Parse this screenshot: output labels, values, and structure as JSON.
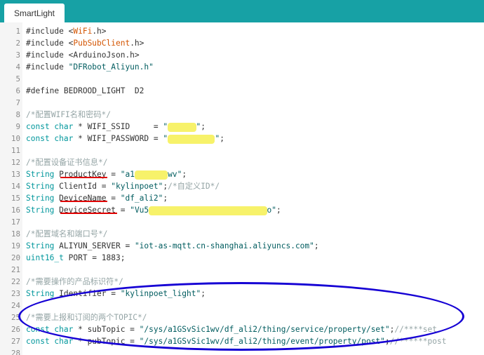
{
  "tab": {
    "title": "SmartLight"
  },
  "lines": [
    {
      "n": "1",
      "parts": [
        [
          "pp",
          "#include <"
        ],
        [
          "lib",
          "WiFi"
        ],
        [
          "pp",
          ".h>"
        ]
      ]
    },
    {
      "n": "2",
      "parts": [
        [
          "pp",
          "#include <"
        ],
        [
          "lib",
          "PubSubClient"
        ],
        [
          "pp",
          ".h>"
        ]
      ]
    },
    {
      "n": "3",
      "parts": [
        [
          "pp",
          "#include <ArduinoJson.h>"
        ]
      ]
    },
    {
      "n": "4",
      "parts": [
        [
          "pp",
          "#include "
        ],
        [
          "str",
          "\"DFRobot_Aliyun.h\""
        ]
      ]
    },
    {
      "n": "5",
      "parts": []
    },
    {
      "n": "6",
      "parts": [
        [
          "pp",
          "#define BEDROOD_LIGHT  D2"
        ]
      ]
    },
    {
      "n": "7",
      "parts": []
    },
    {
      "n": "8",
      "parts": [
        [
          "cm",
          "/*配置WIFI名和密码*/"
        ]
      ]
    },
    {
      "n": "9",
      "parts": [
        [
          "kw",
          "const char"
        ],
        [
          "pp",
          " * WIFI_SSID     = "
        ],
        [
          "str",
          "\""
        ],
        [
          "hl",
          "      "
        ],
        [
          "str",
          "\""
        ],
        [
          "pp",
          ";"
        ]
      ]
    },
    {
      "n": "10",
      "parts": [
        [
          "kw",
          "const char"
        ],
        [
          "pp",
          " * WIFI_PASSWORD = "
        ],
        [
          "str",
          "\""
        ],
        [
          "hl",
          "          "
        ],
        [
          "str",
          "\""
        ],
        [
          "pp",
          ";"
        ]
      ]
    },
    {
      "n": "11",
      "parts": []
    },
    {
      "n": "12",
      "parts": [
        [
          "cm",
          "/*配置设备证书信息*/"
        ]
      ]
    },
    {
      "n": "13",
      "parts": [
        [
          "kw",
          "String"
        ],
        [
          "pp",
          " ProductKey = "
        ],
        [
          "str",
          "\"a1"
        ],
        [
          "hl",
          "       "
        ],
        [
          "str",
          "wv\""
        ],
        [
          "pp",
          ";"
        ]
      ]
    },
    {
      "n": "14",
      "parts": [
        [
          "kw",
          "String"
        ],
        [
          "pp",
          " ClientId = "
        ],
        [
          "str",
          "\"kylinpoet\""
        ],
        [
          "pp",
          ";"
        ],
        [
          "cm",
          "/*自定义ID*/"
        ]
      ]
    },
    {
      "n": "15",
      "parts": [
        [
          "kw",
          "String"
        ],
        [
          "pp",
          " DeviceName = "
        ],
        [
          "str",
          "\"df_ali2\""
        ],
        [
          "pp",
          ";"
        ]
      ]
    },
    {
      "n": "16",
      "parts": [
        [
          "kw",
          "String"
        ],
        [
          "pp",
          " DeviceSecret = "
        ],
        [
          "str",
          "\"Vu5"
        ],
        [
          "hl",
          "                         "
        ],
        [
          "str",
          "o\""
        ],
        [
          "pp",
          ";"
        ]
      ]
    },
    {
      "n": "17",
      "parts": []
    },
    {
      "n": "18",
      "parts": [
        [
          "cm",
          "/*配置域名和端口号*/"
        ]
      ]
    },
    {
      "n": "19",
      "parts": [
        [
          "kw",
          "String"
        ],
        [
          "pp",
          " ALIYUN_SERVER = "
        ],
        [
          "str",
          "\"iot-as-mqtt.cn-shanghai.aliyuncs.com\""
        ],
        [
          "pp",
          ";"
        ]
      ]
    },
    {
      "n": "20",
      "parts": [
        [
          "kw",
          "uint16_t"
        ],
        [
          "pp",
          " PORT = 1883;"
        ]
      ]
    },
    {
      "n": "21",
      "parts": []
    },
    {
      "n": "22",
      "parts": [
        [
          "cm",
          "/*需要操作的产品标识符*/"
        ]
      ]
    },
    {
      "n": "23",
      "parts": [
        [
          "kw",
          "String"
        ],
        [
          "pp",
          " Identifier = "
        ],
        [
          "str",
          "\"kylinpoet_light\""
        ],
        [
          "pp",
          ";"
        ]
      ]
    },
    {
      "n": "24",
      "parts": []
    },
    {
      "n": "25",
      "parts": [
        [
          "cm",
          "/*需要上报和订阅的两个TOPIC*/"
        ]
      ]
    },
    {
      "n": "26",
      "parts": [
        [
          "kw",
          "const char"
        ],
        [
          "pp",
          " * subTopic = "
        ],
        [
          "str",
          "\"/sys/a1GSvSic1wv/df_ali2/thing/service/property/set\""
        ],
        [
          "pp",
          ";"
        ],
        [
          "cm",
          "//****set"
        ]
      ]
    },
    {
      "n": "27",
      "parts": [
        [
          "kw",
          "const char"
        ],
        [
          "pp",
          " * pubTopic = "
        ],
        [
          "str",
          "\"/sys/a1GSvSic1wv/df_ali2/thing/event/property/post\""
        ],
        [
          "pp",
          ";"
        ],
        [
          "cm",
          "//******post"
        ]
      ]
    },
    {
      "n": "28",
      "parts": []
    }
  ],
  "colors": {
    "tabbar": "#17a1a5",
    "keyword": "#00979c",
    "string": "#005c5f",
    "library": "#d35400",
    "comment": "#95a5a6",
    "redaction": "#f7f26a",
    "underline": "#e00000",
    "ellipse": "#1500d4"
  }
}
